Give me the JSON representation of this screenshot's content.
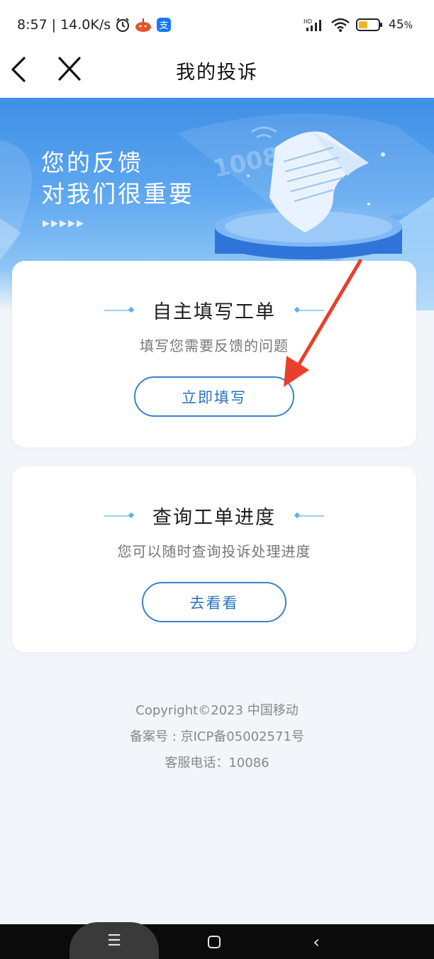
{
  "status_bar": {
    "time": "8:57",
    "network_speed": "14.0K/s",
    "battery_level": "45",
    "battery_unit": "%",
    "icons": [
      "alarm-icon",
      "app-icon-orange",
      "alipay-icon",
      "hd-signal-icon",
      "wifi-icon",
      "battery-icon"
    ]
  },
  "nav": {
    "title": "我的投诉"
  },
  "banner": {
    "line1": "您的反馈",
    "line2": "对我们很重要",
    "arrows": "▶▶▶▶▶",
    "watermark": "10086"
  },
  "cards": [
    {
      "title": "自主填写工单",
      "desc": "填写您需要反馈的问题",
      "button": "立即填写"
    },
    {
      "title": "查询工单进度",
      "desc": "您可以随时查询投诉处理进度",
      "button": "去看看"
    }
  ],
  "footer": {
    "copyright": "Copyright©2023 中国移动",
    "icp": "备案号 : 京ICP备05002571号",
    "hotline": "客服电话：10086"
  },
  "system_nav": {
    "menu_glyph": "☰",
    "back_glyph": "‹"
  },
  "colors": {
    "accent": "#3b82c8",
    "banner_top": "#3f8fe6",
    "annotation_arrow": "#e8402c",
    "battery_fill": "#f0b429"
  }
}
